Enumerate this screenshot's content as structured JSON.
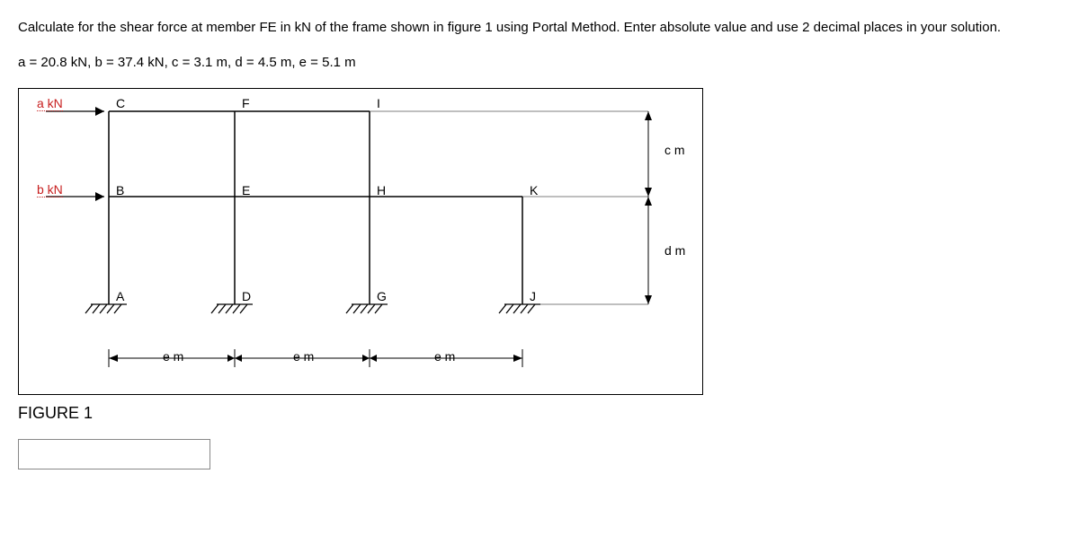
{
  "problem": {
    "text": "Calculate for the shear force at member FE in kN of the frame shown in figure 1 using Portal Method. Enter absolute value and use 2 decimal places in your solution.",
    "params": "a = 20.8 kN, b = 37.4 kN, c = 3.1 m, d = 4.5 m, e = 5.1 m"
  },
  "figure": {
    "caption": "FIGURE 1",
    "loads": {
      "top": "a kN",
      "mid": "b kN"
    },
    "joints": {
      "tl": "C",
      "tm": "F",
      "tr": "I",
      "ml": "B",
      "mm": "E",
      "mr": "H",
      "mk": "K",
      "bl": "A",
      "bm": "D",
      "bg": "G",
      "bj": "J"
    },
    "dims": {
      "bay": "e m",
      "top_story": "c m",
      "bot_story": "d m"
    }
  },
  "answer": {
    "value": "",
    "placeholder": ""
  }
}
